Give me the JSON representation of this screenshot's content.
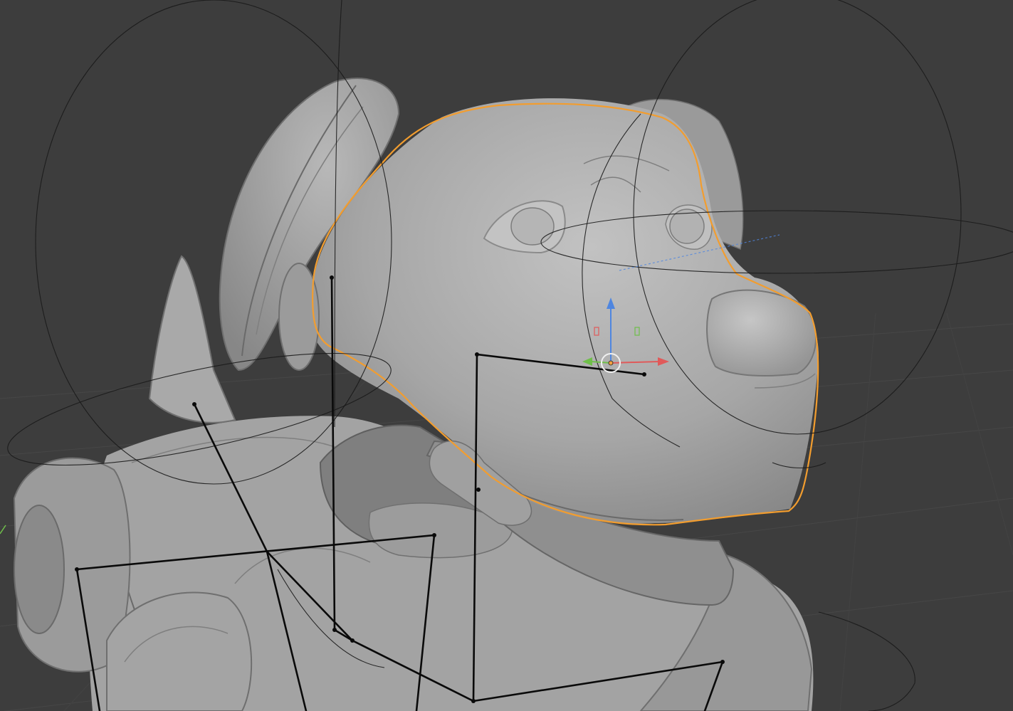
{
  "viewport": {
    "background_color": "#3d3d3d",
    "selection_outline_color": "#f29d2f",
    "gizmo_colors": {
      "x_axis": "#e05a5a",
      "y_axis": "#6fbf4a",
      "z_axis": "#4f86e0",
      "origin": "#f0a040"
    },
    "mesh_color": "#a3a3a3",
    "bone_color": "#0a0a0a",
    "widget_color": "#1a1a1a"
  },
  "objects": [
    {
      "name_icon": "dog-head-mesh-icon"
    },
    {
      "name_icon": "armature-bones-icon"
    },
    {
      "name_icon": "transform-gizmo-icon"
    }
  ]
}
